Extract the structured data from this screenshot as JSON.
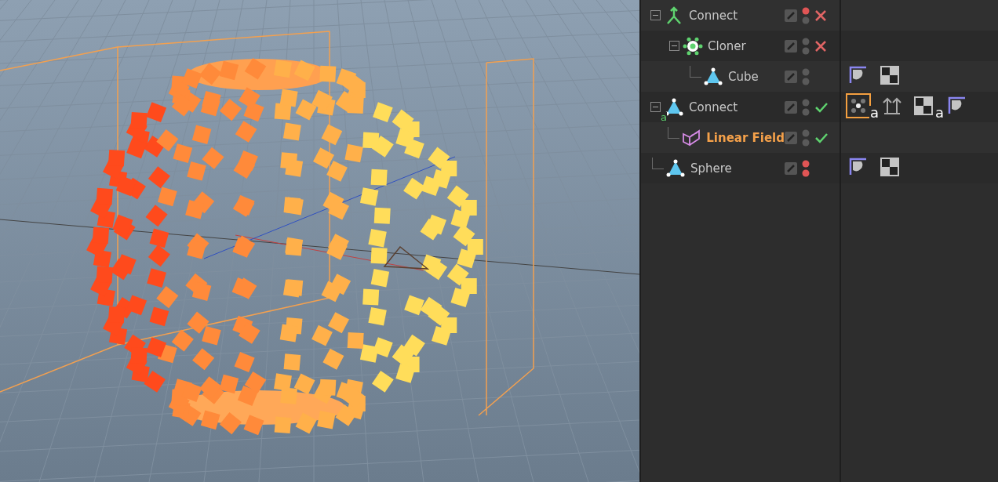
{
  "objects": [
    {
      "name": "Connect",
      "kind": "connect",
      "expanded": true,
      "selected": false,
      "editor_off": true,
      "render_off": false,
      "enabled": false,
      "children": [
        {
          "name": "Cloner",
          "kind": "cloner",
          "expanded": true,
          "selected": false,
          "editor_off": false,
          "render_off": false,
          "enabled": false,
          "children": [
            {
              "name": "Cube",
              "kind": "primitive",
              "selected": false,
              "editor_off": false,
              "render_off": false,
              "tags": [
                {
                  "kind": "phong",
                  "selected": false
                },
                {
                  "kind": "texture",
                  "selected": false
                }
              ]
            }
          ]
        }
      ]
    },
    {
      "name": "Connect",
      "kind": "primitive",
      "icon_badge": "a",
      "expanded": true,
      "selected": false,
      "editor_off": false,
      "render_off": false,
      "enabled": true,
      "tags": [
        {
          "kind": "cloner",
          "selected": true,
          "badge": "a"
        },
        {
          "kind": "align",
          "selected": false
        },
        {
          "kind": "texture",
          "selected": false,
          "badge": "a"
        },
        {
          "kind": "phong",
          "selected": false
        }
      ],
      "children": [
        {
          "name": "Linear Field",
          "kind": "field",
          "selected": true,
          "editor_off": false,
          "render_off": false,
          "enabled": true
        }
      ]
    },
    {
      "name": "Sphere",
      "kind": "primitive",
      "selected": false,
      "editor_off": true,
      "render_off": true,
      "tags": [
        {
          "kind": "phong",
          "selected": false
        },
        {
          "kind": "texture",
          "selected": false
        }
      ]
    }
  ]
}
